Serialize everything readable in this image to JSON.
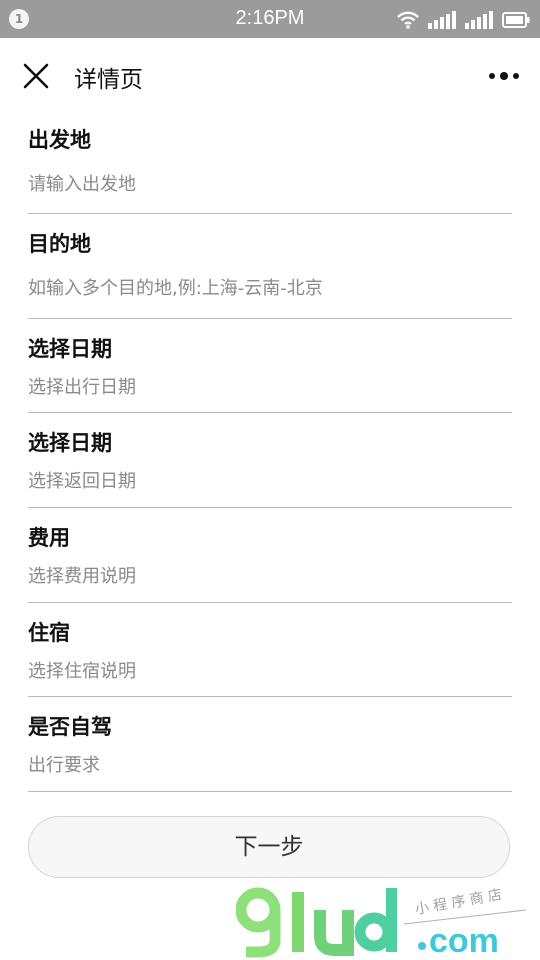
{
  "status_bar": {
    "notification_count": "1",
    "time": "2:16PM",
    "icons": [
      "wifi-icon",
      "signal-icon",
      "signal-icon",
      "battery-icon"
    ]
  },
  "nav": {
    "title": "详情页",
    "close_icon": "close-icon",
    "more_icon": "more-dots-icon"
  },
  "form": {
    "fields": [
      {
        "label": "出发地",
        "placeholder": "请输入出发地"
      },
      {
        "label": "目的地",
        "placeholder": "如输入多个目的地,例:上海-云南-北京"
      },
      {
        "label": "选择日期",
        "placeholder": "选择出行日期"
      },
      {
        "label": "选择日期",
        "placeholder": "选择返回日期"
      },
      {
        "label": "费用",
        "placeholder": "选择费用说明"
      },
      {
        "label": "住宿",
        "placeholder": "选择住宿说明"
      },
      {
        "label": "是否自驾",
        "placeholder": "出行要求"
      }
    ]
  },
  "next_button": {
    "label": "下一步"
  },
  "watermark": {
    "brand": "91ud",
    "domain": ".com",
    "tagline": "小程序商店"
  },
  "colors": {
    "status_bar": "#9b9b9b",
    "divider": "#b8b8b8",
    "placeholder": "#8a8a8a",
    "watermark_green": "#8ee07a",
    "watermark_cyan": "#3fc7dc"
  }
}
